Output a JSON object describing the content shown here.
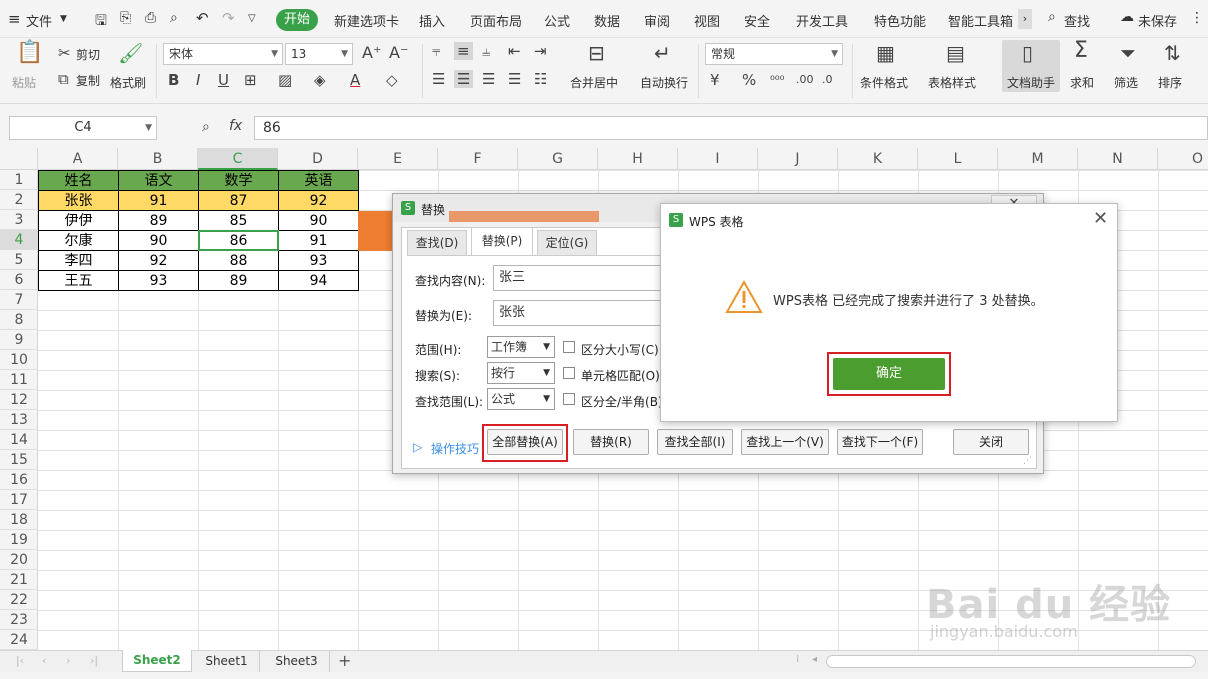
{
  "menubar": {
    "file_label": "文件",
    "tabs": [
      "开始",
      "新建选项卡",
      "插入",
      "页面布局",
      "公式",
      "数据",
      "审阅",
      "视图",
      "安全",
      "开发工具",
      "特色功能",
      "智能工具箱"
    ],
    "search_label": "查找",
    "unsaved_label": "未保存"
  },
  "ribbon": {
    "paste": "粘贴",
    "cut": "剪切",
    "copy": "复制",
    "format_painter": "格式刷",
    "font_name": "宋体",
    "font_size": "13",
    "merge_center": "合并居中",
    "wrap_text": "自动换行",
    "number_format": "常规",
    "conditional_format": "条件格式",
    "table_style": "表格样式",
    "doc_assistant": "文档助手",
    "sum": "求和",
    "filter": "筛选",
    "sort": "排序"
  },
  "formula_bar": {
    "name_box": "C4",
    "fx": "fx",
    "value": "86"
  },
  "columns": [
    "A",
    "B",
    "C",
    "D",
    "E",
    "F",
    "G",
    "H",
    "I",
    "J",
    "K",
    "L",
    "M",
    "N",
    "O"
  ],
  "rows": [
    "1",
    "2",
    "3",
    "4",
    "5",
    "6",
    "7",
    "8",
    "9",
    "10",
    "11",
    "12",
    "13",
    "14",
    "15",
    "16",
    "17",
    "18",
    "19",
    "20",
    "21",
    "22",
    "23",
    "24"
  ],
  "table": {
    "headers": [
      "姓名",
      "语文",
      "数学",
      "英语"
    ],
    "rows": [
      [
        "张张",
        "91",
        "87",
        "92"
      ],
      [
        "伊伊",
        "89",
        "85",
        "90"
      ],
      [
        "尔康",
        "90",
        "86",
        "91"
      ],
      [
        "李四",
        "92",
        "88",
        "93"
      ],
      [
        "王五",
        "93",
        "89",
        "94"
      ]
    ]
  },
  "sheets": [
    "Sheet2",
    "Sheet1",
    "Sheet3"
  ],
  "replace_dialog": {
    "title": "替换",
    "tabs": [
      "查找(D)",
      "替换(P)",
      "定位(G)"
    ],
    "find_label": "查找内容(N):",
    "find_value": "张三",
    "replace_label": "替换为(E):",
    "replace_value": "张张",
    "scope_label": "范围(H):",
    "scope_value": "工作簿",
    "search_label": "搜索(S):",
    "search_value": "按行",
    "lookin_label": "查找范围(L):",
    "lookin_value": "公式",
    "match_case": "区分大小写(C)",
    "match_cell": "单元格匹配(O)",
    "match_width": "区分全/半角(B)",
    "tips": "操作技巧",
    "btn_replace_all": "全部替换(A)",
    "btn_replace": "替换(R)",
    "btn_find_all": "查找全部(I)",
    "btn_find_prev": "查找上一个(V)",
    "btn_find_next": "查找下一个(F)",
    "btn_close": "关闭"
  },
  "message_dialog": {
    "title": "WPS 表格",
    "message": "WPS表格 已经完成了搜索并进行了 3 处替换。",
    "ok": "确定"
  },
  "watermark": {
    "brand": "Bai du 经验",
    "url": "jingyan.baidu.com"
  },
  "colors": {
    "header_green": "#6aa84f",
    "highlight_yellow": "#ffd966",
    "accent_green": "#3aa14b",
    "ok_green": "#4c9d2f",
    "red_box": "#d81e25"
  }
}
